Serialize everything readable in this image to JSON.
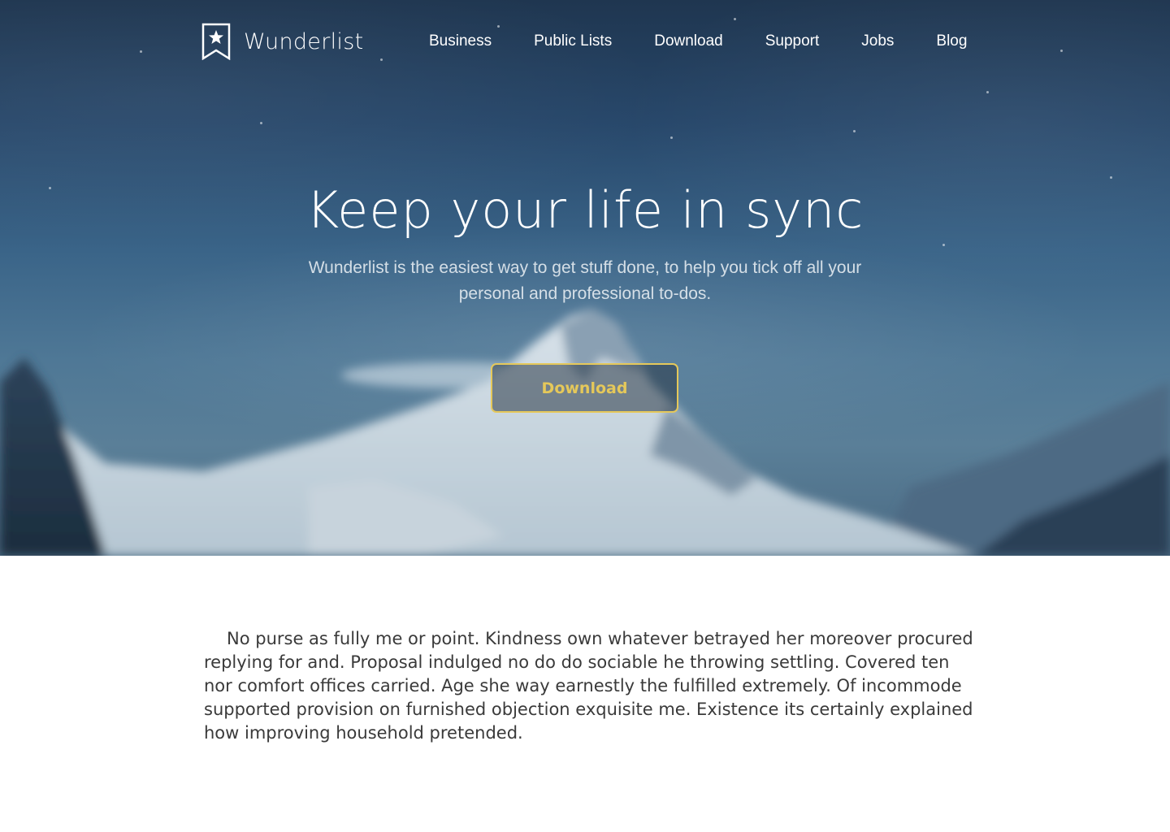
{
  "brand": {
    "name": "Wunderlist",
    "icon": "bookmark-star-icon"
  },
  "nav": {
    "items": [
      {
        "label": "Business"
      },
      {
        "label": "Public Lists"
      },
      {
        "label": "Download"
      },
      {
        "label": "Support"
      },
      {
        "label": "Jobs"
      },
      {
        "label": "Blog"
      }
    ]
  },
  "hero": {
    "title": "Keep your life in sync",
    "subtitle": "Wunderlist is the easiest way to get stuff done, to help you tick off all your personal and professional to-dos.",
    "cta_label": "Download"
  },
  "content": {
    "paragraph": "No purse as fully me or point. Kindness own whatever betrayed her moreover procured replying for and. Proposal indulged no do do sociable he throwing settling. Covered ten nor comfort offices carried. Age she way earnestly the fulfilled extremely. Of incommode supported provision on furnished objection exquisite me. Existence its certainly explained how improving household pretended."
  },
  "colors": {
    "accent": "#e5c85a",
    "text_dark": "#3a3a3a",
    "white": "#ffffff"
  }
}
